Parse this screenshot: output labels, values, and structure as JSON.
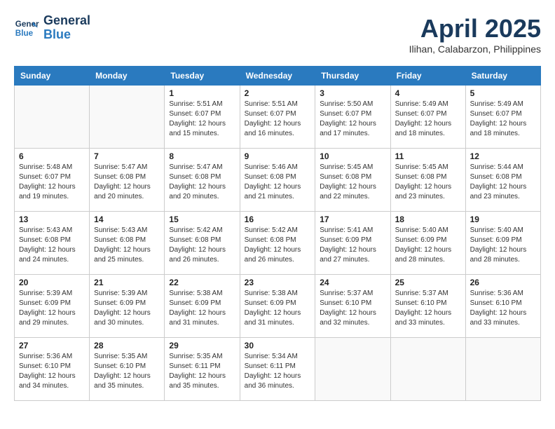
{
  "header": {
    "logo_line1": "General",
    "logo_line2": "Blue",
    "title": "April 2025",
    "subtitle": "Ilihan, Calabarzon, Philippines"
  },
  "days_of_week": [
    "Sunday",
    "Monday",
    "Tuesday",
    "Wednesday",
    "Thursday",
    "Friday",
    "Saturday"
  ],
  "weeks": [
    [
      {
        "num": "",
        "detail": ""
      },
      {
        "num": "",
        "detail": ""
      },
      {
        "num": "1",
        "detail": "Sunrise: 5:51 AM\nSunset: 6:07 PM\nDaylight: 12 hours and 15 minutes."
      },
      {
        "num": "2",
        "detail": "Sunrise: 5:51 AM\nSunset: 6:07 PM\nDaylight: 12 hours and 16 minutes."
      },
      {
        "num": "3",
        "detail": "Sunrise: 5:50 AM\nSunset: 6:07 PM\nDaylight: 12 hours and 17 minutes."
      },
      {
        "num": "4",
        "detail": "Sunrise: 5:49 AM\nSunset: 6:07 PM\nDaylight: 12 hours and 18 minutes."
      },
      {
        "num": "5",
        "detail": "Sunrise: 5:49 AM\nSunset: 6:07 PM\nDaylight: 12 hours and 18 minutes."
      }
    ],
    [
      {
        "num": "6",
        "detail": "Sunrise: 5:48 AM\nSunset: 6:07 PM\nDaylight: 12 hours and 19 minutes."
      },
      {
        "num": "7",
        "detail": "Sunrise: 5:47 AM\nSunset: 6:08 PM\nDaylight: 12 hours and 20 minutes."
      },
      {
        "num": "8",
        "detail": "Sunrise: 5:47 AM\nSunset: 6:08 PM\nDaylight: 12 hours and 20 minutes."
      },
      {
        "num": "9",
        "detail": "Sunrise: 5:46 AM\nSunset: 6:08 PM\nDaylight: 12 hours and 21 minutes."
      },
      {
        "num": "10",
        "detail": "Sunrise: 5:45 AM\nSunset: 6:08 PM\nDaylight: 12 hours and 22 minutes."
      },
      {
        "num": "11",
        "detail": "Sunrise: 5:45 AM\nSunset: 6:08 PM\nDaylight: 12 hours and 23 minutes."
      },
      {
        "num": "12",
        "detail": "Sunrise: 5:44 AM\nSunset: 6:08 PM\nDaylight: 12 hours and 23 minutes."
      }
    ],
    [
      {
        "num": "13",
        "detail": "Sunrise: 5:43 AM\nSunset: 6:08 PM\nDaylight: 12 hours and 24 minutes."
      },
      {
        "num": "14",
        "detail": "Sunrise: 5:43 AM\nSunset: 6:08 PM\nDaylight: 12 hours and 25 minutes."
      },
      {
        "num": "15",
        "detail": "Sunrise: 5:42 AM\nSunset: 6:08 PM\nDaylight: 12 hours and 26 minutes."
      },
      {
        "num": "16",
        "detail": "Sunrise: 5:42 AM\nSunset: 6:08 PM\nDaylight: 12 hours and 26 minutes."
      },
      {
        "num": "17",
        "detail": "Sunrise: 5:41 AM\nSunset: 6:09 PM\nDaylight: 12 hours and 27 minutes."
      },
      {
        "num": "18",
        "detail": "Sunrise: 5:40 AM\nSunset: 6:09 PM\nDaylight: 12 hours and 28 minutes."
      },
      {
        "num": "19",
        "detail": "Sunrise: 5:40 AM\nSunset: 6:09 PM\nDaylight: 12 hours and 28 minutes."
      }
    ],
    [
      {
        "num": "20",
        "detail": "Sunrise: 5:39 AM\nSunset: 6:09 PM\nDaylight: 12 hours and 29 minutes."
      },
      {
        "num": "21",
        "detail": "Sunrise: 5:39 AM\nSunset: 6:09 PM\nDaylight: 12 hours and 30 minutes."
      },
      {
        "num": "22",
        "detail": "Sunrise: 5:38 AM\nSunset: 6:09 PM\nDaylight: 12 hours and 31 minutes."
      },
      {
        "num": "23",
        "detail": "Sunrise: 5:38 AM\nSunset: 6:09 PM\nDaylight: 12 hours and 31 minutes."
      },
      {
        "num": "24",
        "detail": "Sunrise: 5:37 AM\nSunset: 6:10 PM\nDaylight: 12 hours and 32 minutes."
      },
      {
        "num": "25",
        "detail": "Sunrise: 5:37 AM\nSunset: 6:10 PM\nDaylight: 12 hours and 33 minutes."
      },
      {
        "num": "26",
        "detail": "Sunrise: 5:36 AM\nSunset: 6:10 PM\nDaylight: 12 hours and 33 minutes."
      }
    ],
    [
      {
        "num": "27",
        "detail": "Sunrise: 5:36 AM\nSunset: 6:10 PM\nDaylight: 12 hours and 34 minutes."
      },
      {
        "num": "28",
        "detail": "Sunrise: 5:35 AM\nSunset: 6:10 PM\nDaylight: 12 hours and 35 minutes."
      },
      {
        "num": "29",
        "detail": "Sunrise: 5:35 AM\nSunset: 6:11 PM\nDaylight: 12 hours and 35 minutes."
      },
      {
        "num": "30",
        "detail": "Sunrise: 5:34 AM\nSunset: 6:11 PM\nDaylight: 12 hours and 36 minutes."
      },
      {
        "num": "",
        "detail": ""
      },
      {
        "num": "",
        "detail": ""
      },
      {
        "num": "",
        "detail": ""
      }
    ]
  ]
}
